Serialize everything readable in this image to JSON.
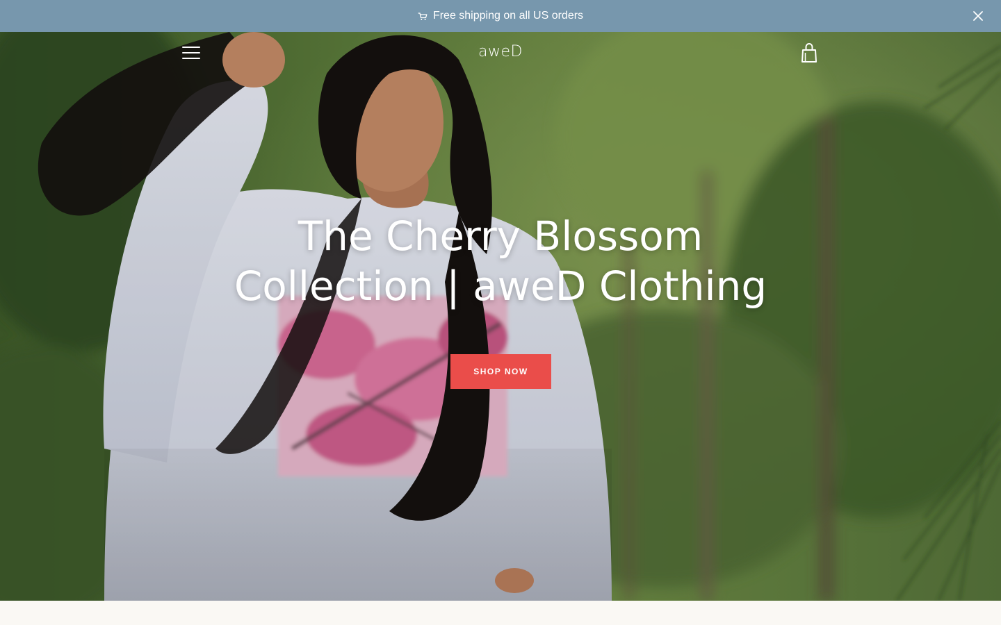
{
  "announcement": {
    "text": "Free shipping on all US orders",
    "icon": "shopping-cart-icon",
    "close_icon": "close-icon",
    "background": "#7797ad"
  },
  "header": {
    "logo": "aweD",
    "menu_icon": "hamburger-menu-icon",
    "cart_icon": "shopping-bag-icon"
  },
  "hero": {
    "title": "The Cherry Blossom Collection | aweD Clothing",
    "cta_label": "SHOP NOW",
    "cta_color": "#ea4d4a"
  }
}
